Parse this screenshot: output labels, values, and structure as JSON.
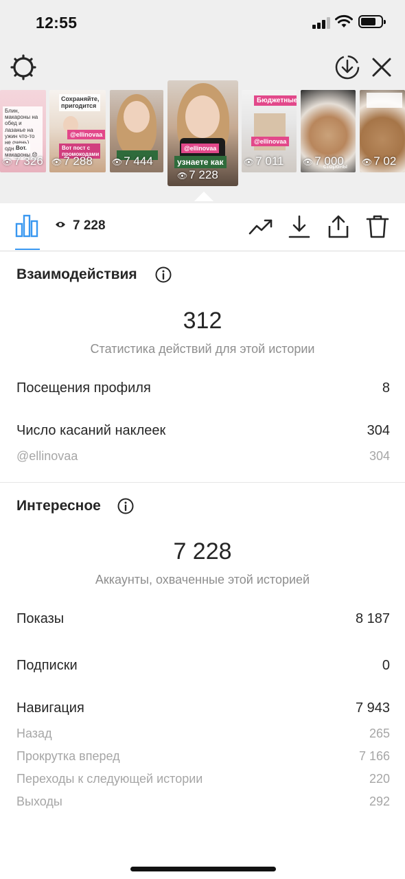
{
  "status_bar": {
    "time": "12:55"
  },
  "stories": [
    {
      "views": "7 326",
      "caption": "Блин, макароны на обед и лазанье на ужин что-то не очень) одни макароны 😞",
      "tag": "Вот."
    },
    {
      "views": "7 288",
      "caption": "Сохраняйте, пригодится",
      "tag": "@ellinovaa",
      "tag2": "Вот пост с промокодами"
    },
    {
      "views": "7 444",
      "caption": "",
      "tag": ""
    },
    {
      "views": "7 228",
      "caption": "",
      "tag": "@ellinovaa",
      "tag2": "узнаете как"
    },
    {
      "views": "7 011",
      "caption": "Бюджетные",
      "tag": "@ellinovaa"
    },
    {
      "views": "7 000",
      "caption": "стороны",
      "tag": ""
    },
    {
      "views": "7 02",
      "caption": "",
      "tag": ""
    }
  ],
  "toolbar": {
    "reach": "7 228"
  },
  "interactions": {
    "title": "Взаимодействия",
    "total": "312",
    "caption": "Статистика действий для этой истории",
    "rows": [
      {
        "label": "Посещения профиля",
        "value": "8"
      },
      {
        "label": "Число касаний наклеек",
        "value": "304"
      }
    ],
    "sub_rows": [
      {
        "label": "@ellinovaa",
        "value": "304"
      }
    ]
  },
  "discovery": {
    "title": "Интересное",
    "total": "7 228",
    "caption": "Аккаунты, охваченные этой историей",
    "rows": [
      {
        "label": "Показы",
        "value": "8 187"
      },
      {
        "label": "Подписки",
        "value": "0"
      },
      {
        "label": "Навигация",
        "value": "7 943"
      }
    ],
    "sub_rows": [
      {
        "label": "Назад",
        "value": "265"
      },
      {
        "label": "Прокрутка вперед",
        "value": "7 166"
      },
      {
        "label": "Переходы к следующей истории",
        "value": "220"
      },
      {
        "label": "Выходы",
        "value": "292"
      }
    ]
  },
  "colors": {
    "accent": "#3897f0",
    "text": "#262626",
    "muted": "#8e8e8e",
    "background_top": "#efefef"
  }
}
